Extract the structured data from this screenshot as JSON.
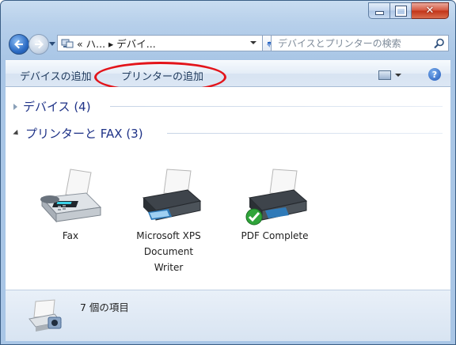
{
  "window": {
    "caption_buttons": [
      "minimize-icon",
      "maximize-icon",
      "close-icon"
    ]
  },
  "address_bar": {
    "crumbs": "« ハ... ▸ デバイ...",
    "search_placeholder": "デバイスとプリンターの検索"
  },
  "command_bar": {
    "devices_label": "デバイスの追加",
    "add_printer_label": "プリンターの追加",
    "highlight_color": "#e3141a"
  },
  "groups": {
    "devices": "デバイス (4)",
    "printers": "プリンターと FAX (3)"
  },
  "printers": [
    {
      "label": "Fax",
      "icon": "fax-icon"
    },
    {
      "label": "Microsoft XPS\nDocument\nWriter",
      "icon": "printer-icon"
    },
    {
      "label": "PDF Complete",
      "icon": "default-printer-icon",
      "default": true
    }
  ],
  "status": {
    "item_count": "7 個の項目"
  },
  "colors": {
    "accent": "#1e3287",
    "window_frame": "#a9c6e6",
    "close_button": "#c23317",
    "default_check": "#2fa43a"
  }
}
